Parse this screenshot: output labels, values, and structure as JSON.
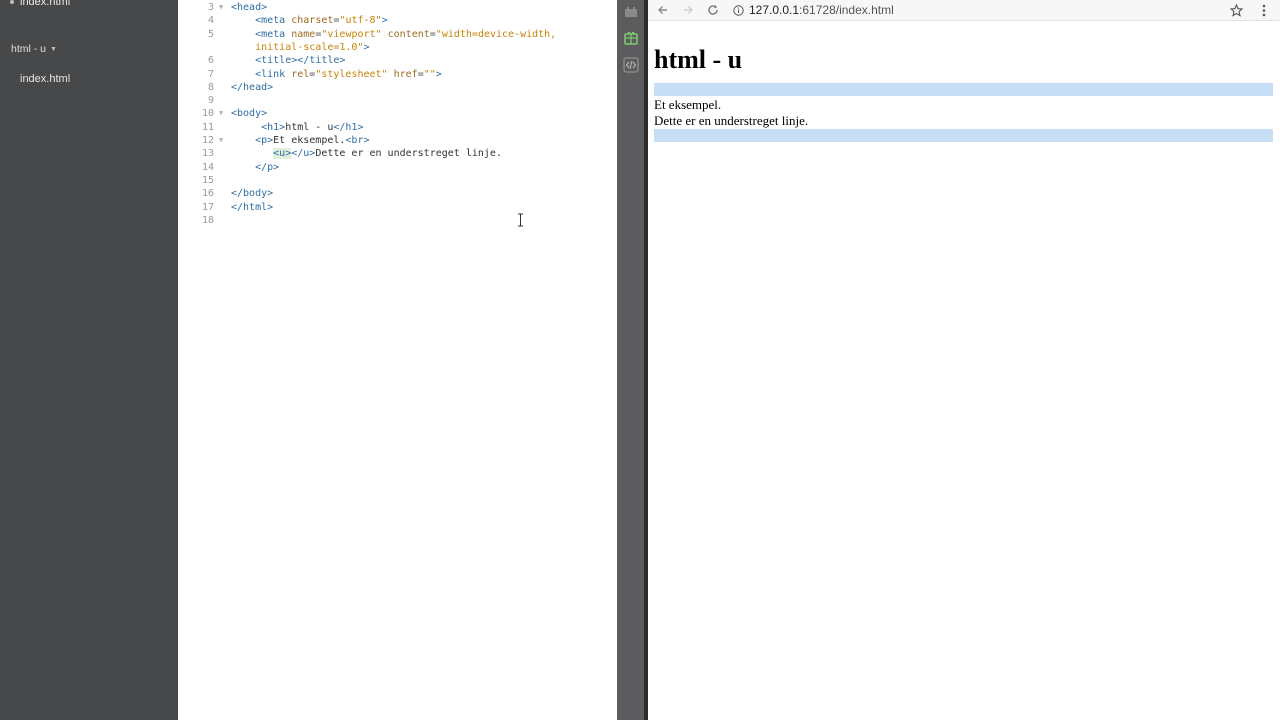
{
  "sidebar": {
    "open_file": "index.html",
    "project": "html - u",
    "files": [
      "index.html"
    ]
  },
  "editor": {
    "lines": [
      {
        "n": "3",
        "fold": "▼",
        "html": "<span class=\"tag\">&lt;head&gt;</span>"
      },
      {
        "n": "4",
        "fold": "",
        "html": "    <span class=\"tag\">&lt;meta</span> <span class=\"attr\">charset</span>=<span class=\"str\">\"utf-8\"</span><span class=\"tag\">&gt;</span>"
      },
      {
        "n": "5",
        "fold": "",
        "html": "    <span class=\"tag\">&lt;meta</span> <span class=\"attr\">name</span>=<span class=\"str\">\"viewport\"</span> <span class=\"attr\">content</span>=<span class=\"str\">\"width=device-width,</span>"
      },
      {
        "n": "",
        "fold": "",
        "html": "    <span class=\"str\">initial-scale=1.0\"</span><span class=\"tag\">&gt;</span>"
      },
      {
        "n": "6",
        "fold": "",
        "html": "    <span class=\"tag\">&lt;title&gt;&lt;/title&gt;</span>"
      },
      {
        "n": "7",
        "fold": "",
        "html": "    <span class=\"tag\">&lt;link</span> <span class=\"attr\">rel</span>=<span class=\"str\">\"stylesheet\"</span> <span class=\"attr\">href</span>=<span class=\"str\">\"\"</span><span class=\"tag\">&gt;</span>"
      },
      {
        "n": "8",
        "fold": "",
        "html": "<span class=\"tag\">&lt;/head&gt;</span>"
      },
      {
        "n": "9",
        "fold": "",
        "html": ""
      },
      {
        "n": "10",
        "fold": "▼",
        "html": "<span class=\"tag\">&lt;body&gt;</span>"
      },
      {
        "n": "11",
        "fold": "",
        "html": "     <span class=\"tag\">&lt;h1&gt;</span><span class=\"txt\">html - u</span><span class=\"tag\">&lt;/h1&gt;</span>"
      },
      {
        "n": "12",
        "fold": "▼",
        "html": "    <span class=\"tag\">&lt;p&gt;</span><span class=\"txt\">Et eksempel.</span><span class=\"tag\">&lt;br&gt;</span>"
      },
      {
        "n": "13",
        "fold": "",
        "html": "       <span class=\"tag hl\">&lt;u&gt;</span><span class=\"tag\">&lt;/u&gt;</span><span class=\"txt\">Dette er en understreget linje.</span>"
      },
      {
        "n": "14",
        "fold": "",
        "html": "    <span class=\"tag\">&lt;/p&gt;</span>"
      },
      {
        "n": "15",
        "fold": "",
        "html": ""
      },
      {
        "n": "16",
        "fold": "",
        "html": "<span class=\"tag\">&lt;/body&gt;</span>"
      },
      {
        "n": "17",
        "fold": "",
        "html": "<span class=\"tag\">&lt;/html&gt;</span>"
      },
      {
        "n": "18",
        "fold": "",
        "html": ""
      }
    ]
  },
  "browser": {
    "url_host": "127.0.0.1",
    "url_rest": ":61728/index.html",
    "page": {
      "heading": "html - u",
      "line1": "Et eksempel.",
      "line2": "Dette er en understreget linje."
    }
  },
  "colors": {
    "sidebar_bg": "#47484a",
    "tag": "#2f6da3",
    "string": "#c8820a",
    "highlight_band": "#c6dff7"
  },
  "icons": [
    "back-arrow-icon",
    "forward-arrow-icon",
    "reload-icon",
    "info-icon",
    "star-icon",
    "kebab-menu-icon",
    "live-preview-icon",
    "extension-icon",
    "code-icon"
  ]
}
